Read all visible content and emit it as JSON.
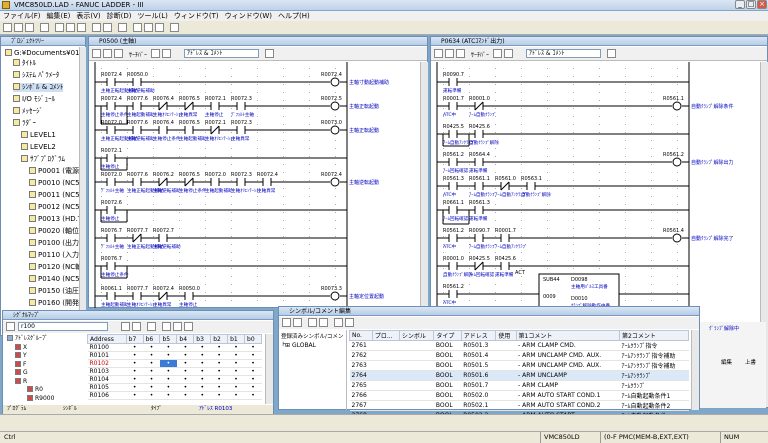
{
  "app": {
    "title": "VMC850LD.LAD - FANUC LADDER - III"
  },
  "menu": [
    "ファイル(F)",
    "編集(E)",
    "表示(V)",
    "診断(D)",
    "ツール(L)",
    "ウィンドウ(T)",
    "ウィンドウ(W)",
    "ヘルプ(H)"
  ],
  "project_tree": {
    "title": "ﾌﾟﾛｼﾞｪｸﾄﾂﾘｰ",
    "root": "G:¥Documents¥01_",
    "items": [
      {
        "label": "ﾀｲﾄﾙ",
        "indent": 1
      },
      {
        "label": "ｼｽﾃﾑ ﾊﾟﾗﾒｰﾀ",
        "indent": 1
      },
      {
        "label": "ｼﾝﾎﾞﾙ & ｺﾒﾝﾄ",
        "indent": 1,
        "selected": true
      },
      {
        "label": "I/O ﾓｼﾞｭｰﾙ",
        "indent": 1
      },
      {
        "label": "ﾒｯｾｰｼﾞ",
        "indent": 1
      },
      {
        "label": "ﾗﾀﾞｰ",
        "indent": 1
      },
      {
        "label": "LEVEL1",
        "indent": 2
      },
      {
        "label": "LEVEL2",
        "indent": 2
      },
      {
        "label": "ｻﾌﾞﾌﾟﾛｸﾞﾗﾑ",
        "indent": 2
      },
      {
        "label": "P0001 (電源",
        "indent": 3
      },
      {
        "label": "P0010 (NC5",
        "indent": 3
      },
      {
        "label": "P0011 (NC5",
        "indent": 3
      },
      {
        "label": "P0012 (NC5",
        "indent": 3
      },
      {
        "label": "P0013 (HD.T",
        "indent": 3
      },
      {
        "label": "P0020 (軸位",
        "indent": 3
      },
      {
        "label": "P0100 (出力",
        "indent": 3
      },
      {
        "label": "P0110 (入力",
        "indent": 3
      },
      {
        "label": "P0120 (NC軸",
        "indent": 3
      },
      {
        "label": "P0140 (NC5",
        "indent": 3
      },
      {
        "label": "P0150 (油圧",
        "indent": 3
      },
      {
        "label": "P0160 (開発",
        "indent": 3
      },
      {
        "label": "P0200 (操作",
        "indent": 3
      }
    ]
  },
  "ladder_left": {
    "title": "P0500 (主軸)",
    "toolbar_combo": "ｱﾄﾞﾚｽ & ｺﾒﾝﾄ",
    "search_label": "ｻｰﾁﾊﾞｰ",
    "coils": [
      {
        "addr": "R0072.4",
        "comment": "主軸寸動起動補助"
      },
      {
        "addr": "R0072.5",
        "comment": "主軸正転起動"
      },
      {
        "addr": "R0073.0",
        "comment": "主軸正転起動"
      },
      {
        "addr": "R0072.4",
        "comment": "主軸逆転起動"
      },
      {
        "addr": "R0072.6",
        "comment": "主軸逆転起動"
      },
      {
        "addr": "R0073.3",
        "comment": "主軸定位置起動"
      }
    ],
    "contacts": [
      "R0072.4",
      "R0050.0",
      "R0072.4",
      "R0077.6",
      "R0076.4",
      "R0076.5",
      "R0072.1",
      "R0072.3",
      "R0072.0",
      "R0077.6",
      "R0076.4",
      "R0076.5",
      "R0072.1",
      "R0072.3",
      "R0072.1",
      "R0072.0",
      "R0077.6",
      "R0076.2",
      "R0076.5",
      "R0072.0",
      "R0072.3",
      "R0072.4",
      "R0072.6",
      "R0076.7",
      "R0077.7",
      "R0072.7",
      "R0076.7",
      "R0061.1",
      "R0077.7"
    ],
    "comments": [
      "主軸正転起動補助",
      "主軸逆転補助",
      "主軸停止条件",
      "主軸起動補助",
      "主軸ｵﾘｴﾝﾃｰｼｮﾝ",
      "主軸異常",
      "主軸停止",
      "ﾃﾞﾌｫﾙﾄ主軸"
    ]
  },
  "ladder_right": {
    "title": "P0634 (ATCｺﾏﾝﾄﾞ出力)",
    "toolbar_combo": "ｱﾄﾞﾚｽ & ｺﾒﾝﾄ",
    "search_label": "ｻｰﾁﾊﾞｰ",
    "coils": [
      {
        "addr": "R0561.1",
        "comment": "自動ｸﾗﾝﾌﾟ解除条件"
      },
      {
        "addr": "R0561.2",
        "comment": "自動ｸﾗﾝﾌﾟ解除出力"
      },
      {
        "addr": "R0561.3",
        "comment": "自動ｸﾗﾝﾌﾟ解除中"
      },
      {
        "addr": "R0561.4",
        "comment": "自動ｸﾗﾝﾌﾟ解除完了"
      }
    ],
    "contacts": [
      "R0090.7",
      "R0001.7",
      "R0001.0",
      "R0425.5",
      "R0425.6",
      "R0561.2",
      "R0564.4",
      "R0561.3",
      "R0561.1",
      "R0561.0",
      "R0563.1",
      "R0661.1",
      "R0561.3",
      "R0561.2"
    ],
    "comments": [
      "運転準備",
      "ATC中",
      "ｱｰﾑ自動ｸﾗﾝﾌﾟ",
      "ｱｰﾑ自動ｱﾝｸﾗﾝﾌﾟ",
      "自動ｸﾗﾝﾌﾟ解除",
      "ｱｰﾑ回転確認"
    ],
    "func": {
      "name": "SUB44",
      "label": "ACT",
      "num": "0009",
      "d1": "D0098",
      "d1c": "主軸用ﾊﾟﾙｽ工具番",
      "d2": "D0010",
      "d2c": "ｸﾗﾝﾌﾟ解除動作中番"
    }
  },
  "signal_map": {
    "title": "ｼｸﾞﾅﾙﾏｯﾌﾟ",
    "search": "r100",
    "cols": [
      "Address",
      "b7",
      "b6",
      "b5",
      "b4",
      "b3",
      "b2",
      "b1",
      "b0"
    ],
    "rows": [
      "R0100",
      "R0101",
      "R0102",
      "R0103",
      "R0104",
      "R0105",
      "R0106"
    ],
    "tree": [
      "ｱﾄﾞﾚｽｸﾞﾙｰﾌﾟ",
      "X",
      "Y",
      "F",
      "G",
      "R",
      "R0",
      "R9000"
    ],
    "footer": {
      "left": "ﾌﾟﾛｸﾞﾗﾑ",
      "mid": "ｼﾝﾎﾞﾙ",
      "type": "ﾀｲﾌﾟ",
      "addr": "ｱﾄﾞﾚｽ R0103"
    }
  },
  "symbol_editor": {
    "title": "シンボル/コメント編集",
    "tree_header": "登録済みシンボル/コメント",
    "tree_item": "GLOBAL",
    "cols": [
      "No.",
      "プロ...",
      "シンボル",
      "タイプ",
      "アドレス",
      "使用",
      "第1コメント",
      "第2コメント"
    ],
    "rows": [
      [
        "2761",
        "",
        "",
        "BOOL",
        "R0501.3",
        "",
        "ARM CLAMP CMD.",
        "ｱｰﾑｸﾗﾝﾌﾟ指令"
      ],
      [
        "2762",
        "",
        "",
        "BOOL",
        "R0501.4",
        "",
        "ARM UNCLAMP CMD. AUX.",
        "ｱｰﾑｱﾝｸﾗﾝﾌﾟ指令補助"
      ],
      [
        "2763",
        "",
        "",
        "BOOL",
        "R0501.5",
        "",
        "ARM UNCLAMP CMD. AUX.",
        "ｱｰﾑｱﾝｸﾗﾝﾌﾟ指令補助"
      ],
      [
        "2764",
        "",
        "",
        "BOOL",
        "R0501.6",
        "",
        "ARM UNCLAMP",
        "ｱｰﾑｱﾝｸﾗﾝﾌﾟ"
      ],
      [
        "2765",
        "",
        "",
        "BOOL",
        "R0501.7",
        "",
        "ARM CLAMP",
        "ｱｰﾑｸﾗﾝﾌﾟ"
      ],
      [
        "2766",
        "",
        "",
        "BOOL",
        "R0502.0",
        "",
        "ARM AUTO START COND.1",
        "ｱｰﾑ自動起動条件1"
      ],
      [
        "2767",
        "",
        "",
        "BOOL",
        "R0502.1",
        "",
        "ARM AUTO START COND.2",
        "ｱｰﾑ自動起動条件2"
      ],
      [
        "2768",
        "",
        "",
        "BOOL",
        "R0502.2",
        "",
        "ARM AUTO START",
        "ｱｰﾑ自動起動条件"
      ]
    ]
  },
  "right_strip": {
    "label1": "ｸﾞﾗﾝﾌﾟ解除中",
    "label2": "編集",
    "label3": "上書"
  },
  "status": {
    "left": "Ctrl",
    "file": "VMC850LD",
    "mode": "(0-F PMC(MEM-B,EXT,EXT)",
    "key": "NUM"
  }
}
